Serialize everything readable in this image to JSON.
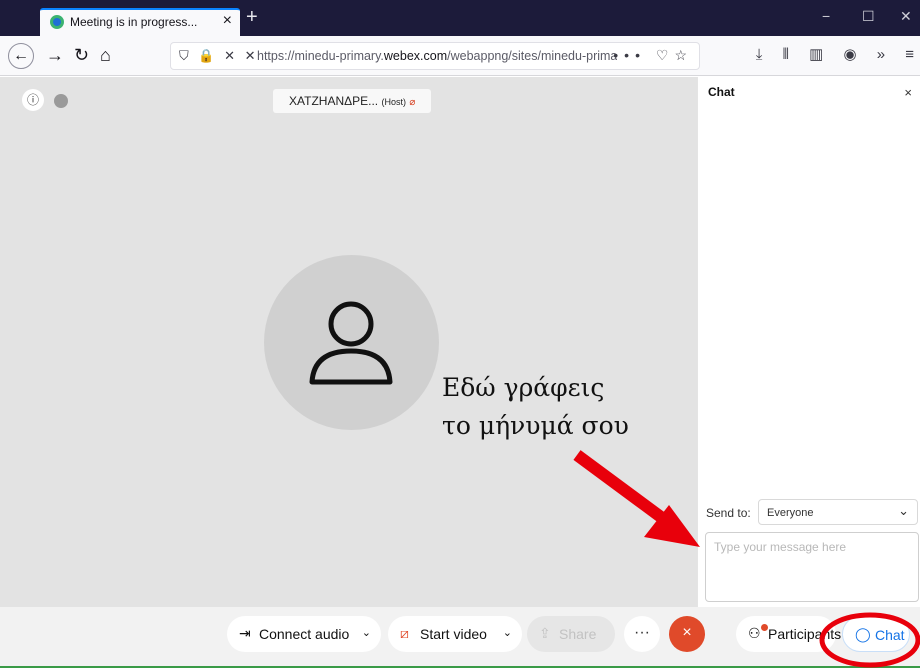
{
  "browser": {
    "tab_title": "Meeting is in progress...",
    "tab_close": "×",
    "new_tab": "+",
    "window_controls": [
      "−",
      "☐",
      "✕"
    ],
    "url_prefix": "https://minedu-primary.",
    "url_domain": "webex.com",
    "url_suffix": "/webappng/sites/minedu-primar",
    "url_more": "•••",
    "icons": [
      "back-icon",
      "forward-icon",
      "reload-icon",
      "home-icon",
      "shield-icon",
      "lock-icon",
      "camera-blocked-icon",
      "mic-blocked-icon",
      "pocket-icon",
      "bookmark-star-icon",
      "download-icon",
      "library-icon",
      "sidebar-icon",
      "account-icon",
      "overflow-icon",
      "menu-icon"
    ]
  },
  "meeting": {
    "host_name": "ΧΑΤΖΗΑΝΔΡΕ...",
    "host_tag": "(Host)",
    "info_icon": "ⓘ"
  },
  "annotation": {
    "line1": "Εδώ γράφεις",
    "line2": "το μήνυμά σου",
    "arrow_color": "#e8000b",
    "circle_color": "#e8000b"
  },
  "chat": {
    "title": "Chat",
    "close": "×",
    "send_to_label": "Send to:",
    "send_to_value": "Everyone",
    "message_placeholder": "Type your message here"
  },
  "controls": {
    "connect_audio": "Connect audio",
    "start_video": "Start video",
    "share": "Share",
    "more": "···",
    "end": "×",
    "participants": "Participants",
    "chat": "Chat"
  },
  "colors": {
    "end_button": "#e04a2a",
    "chat_accent": "#1473e6",
    "tabbar": "#1c1b3a"
  }
}
